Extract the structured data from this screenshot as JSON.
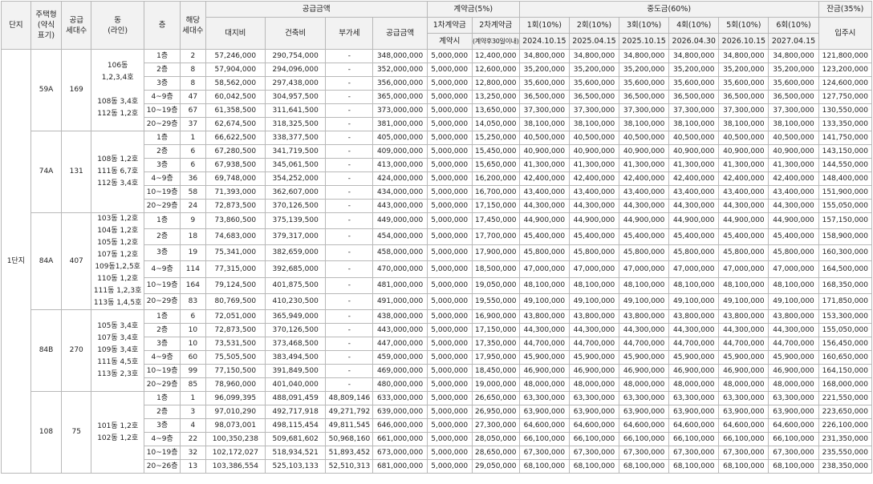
{
  "headers": {
    "danji": "단지",
    "type": "주택형\n(약식\n표기)",
    "supply_units": "공급\n세대수",
    "dong": "동\n(라인)",
    "floor": "층",
    "units": "해당\n세대수",
    "supply_price": "공급금액",
    "land": "대지비",
    "building": "건축비",
    "vat": "부가세",
    "total": "공급금액",
    "contract": "계약금(5%)",
    "c1": "1차계약금",
    "c2": "2차계약금",
    "c1_when": "계약시",
    "c2_when": "(계약후30일이내)",
    "middle": "중도금(60%)",
    "m1": "1회(10%)",
    "m2": "2회(10%)",
    "m3": "3회(10%)",
    "m4": "4회(10%)",
    "m5": "5회(10%)",
    "m6": "6회(10%)",
    "m1_date": "2024.10.15",
    "m2_date": "2025.04.15",
    "m3_date": "2025.10.15",
    "m4_date": "2026.04.30",
    "m5_date": "2026.10.15",
    "m6_date": "2027.04.15",
    "balance": "잔금(35%)",
    "balance_when": "입주시"
  },
  "danji_name": "1단지",
  "groups": [
    {
      "type": "59A",
      "supply": "169",
      "dong": "106동\n1,2,3,4호\n\n108동 3,4호\n112동 1,2호",
      "rows": [
        [
          "1층",
          "2",
          "57,246,000",
          "290,754,000",
          "-",
          "348,000,000",
          "5,000,000",
          "12,400,000",
          "34,800,000",
          "34,800,000",
          "34,800,000",
          "34,800,000",
          "34,800,000",
          "34,800,000",
          "121,800,000"
        ],
        [
          "2층",
          "8",
          "57,904,000",
          "294,096,000",
          "-",
          "352,000,000",
          "5,000,000",
          "12,600,000",
          "35,200,000",
          "35,200,000",
          "35,200,000",
          "35,200,000",
          "35,200,000",
          "35,200,000",
          "123,200,000"
        ],
        [
          "3층",
          "8",
          "58,562,000",
          "297,438,000",
          "-",
          "356,000,000",
          "5,000,000",
          "12,800,000",
          "35,600,000",
          "35,600,000",
          "35,600,000",
          "35,600,000",
          "35,600,000",
          "35,600,000",
          "124,600,000"
        ],
        [
          "4~9층",
          "47",
          "60,042,500",
          "304,957,500",
          "-",
          "365,000,000",
          "5,000,000",
          "13,250,000",
          "36,500,000",
          "36,500,000",
          "36,500,000",
          "36,500,000",
          "36,500,000",
          "36,500,000",
          "127,750,000"
        ],
        [
          "10~19층",
          "67",
          "61,358,500",
          "311,641,500",
          "-",
          "373,000,000",
          "5,000,000",
          "13,650,000",
          "37,300,000",
          "37,300,000",
          "37,300,000",
          "37,300,000",
          "37,300,000",
          "37,300,000",
          "130,550,000"
        ],
        [
          "20~29층",
          "37",
          "62,674,500",
          "318,325,500",
          "-",
          "381,000,000",
          "5,000,000",
          "14,050,000",
          "38,100,000",
          "38,100,000",
          "38,100,000",
          "38,100,000",
          "38,100,000",
          "38,100,000",
          "133,350,000"
        ]
      ]
    },
    {
      "type": "74A",
      "supply": "131",
      "dong": "108동 1,2호\n111동 6,7호\n112동 3,4호",
      "rows": [
        [
          "1층",
          "1",
          "66,622,500",
          "338,377,500",
          "-",
          "405,000,000",
          "5,000,000",
          "15,250,000",
          "40,500,000",
          "40,500,000",
          "40,500,000",
          "40,500,000",
          "40,500,000",
          "40,500,000",
          "141,750,000"
        ],
        [
          "2층",
          "6",
          "67,280,500",
          "341,719,500",
          "-",
          "409,000,000",
          "5,000,000",
          "15,450,000",
          "40,900,000",
          "40,900,000",
          "40,900,000",
          "40,900,000",
          "40,900,000",
          "40,900,000",
          "143,150,000"
        ],
        [
          "3층",
          "6",
          "67,938,500",
          "345,061,500",
          "-",
          "413,000,000",
          "5,000,000",
          "15,650,000",
          "41,300,000",
          "41,300,000",
          "41,300,000",
          "41,300,000",
          "41,300,000",
          "41,300,000",
          "144,550,000"
        ],
        [
          "4~9층",
          "36",
          "69,748,000",
          "354,252,000",
          "-",
          "424,000,000",
          "5,000,000",
          "16,200,000",
          "42,400,000",
          "42,400,000",
          "42,400,000",
          "42,400,000",
          "42,400,000",
          "42,400,000",
          "148,400,000"
        ],
        [
          "10~19층",
          "58",
          "71,393,000",
          "362,607,000",
          "-",
          "434,000,000",
          "5,000,000",
          "16,700,000",
          "43,400,000",
          "43,400,000",
          "43,400,000",
          "43,400,000",
          "43,400,000",
          "43,400,000",
          "151,900,000"
        ],
        [
          "20~29층",
          "24",
          "72,873,500",
          "370,126,500",
          "-",
          "443,000,000",
          "5,000,000",
          "17,150,000",
          "44,300,000",
          "44,300,000",
          "44,300,000",
          "44,300,000",
          "44,300,000",
          "44,300,000",
          "155,050,000"
        ]
      ]
    },
    {
      "type": "84A",
      "supply": "407",
      "dong": "103동 1,2호\n104동 1,2호\n105동 1,2호\n107동 1,2호\n109동1,2,5호\n110동 1,2호\n111동 1,2,3호\n113동 1,4,5호",
      "rows": [
        [
          "1층",
          "9",
          "73,860,500",
          "375,139,500",
          "-",
          "449,000,000",
          "5,000,000",
          "17,450,000",
          "44,900,000",
          "44,900,000",
          "44,900,000",
          "44,900,000",
          "44,900,000",
          "44,900,000",
          "157,150,000"
        ],
        [
          "2층",
          "18",
          "74,683,000",
          "379,317,000",
          "-",
          "454,000,000",
          "5,000,000",
          "17,700,000",
          "45,400,000",
          "45,400,000",
          "45,400,000",
          "45,400,000",
          "45,400,000",
          "45,400,000",
          "158,900,000"
        ],
        [
          "3층",
          "19",
          "75,341,000",
          "382,659,000",
          "-",
          "458,000,000",
          "5,000,000",
          "17,900,000",
          "45,800,000",
          "45,800,000",
          "45,800,000",
          "45,800,000",
          "45,800,000",
          "45,800,000",
          "160,300,000"
        ],
        [
          "4~9층",
          "114",
          "77,315,000",
          "392,685,000",
          "-",
          "470,000,000",
          "5,000,000",
          "18,500,000",
          "47,000,000",
          "47,000,000",
          "47,000,000",
          "47,000,000",
          "47,000,000",
          "47,000,000",
          "164,500,000"
        ],
        [
          "10~19층",
          "164",
          "79,124,500",
          "401,875,500",
          "-",
          "481,000,000",
          "5,000,000",
          "19,050,000",
          "48,100,000",
          "48,100,000",
          "48,100,000",
          "48,100,000",
          "48,100,000",
          "48,100,000",
          "168,350,000"
        ],
        [
          "20~29층",
          "83",
          "80,769,500",
          "410,230,500",
          "-",
          "491,000,000",
          "5,000,000",
          "19,550,000",
          "49,100,000",
          "49,100,000",
          "49,100,000",
          "49,100,000",
          "49,100,000",
          "49,100,000",
          "171,850,000"
        ]
      ]
    },
    {
      "type": "84B",
      "supply": "270",
      "dong": "105동 3,4호\n107동 3,4호\n109동 3,4호\n111동 4,5호\n113동 2,3호",
      "rows": [
        [
          "1층",
          "6",
          "72,051,000",
          "365,949,000",
          "-",
          "438,000,000",
          "5,000,000",
          "16,900,000",
          "43,800,000",
          "43,800,000",
          "43,800,000",
          "43,800,000",
          "43,800,000",
          "43,800,000",
          "153,300,000"
        ],
        [
          "2층",
          "10",
          "72,873,500",
          "370,126,500",
          "-",
          "443,000,000",
          "5,000,000",
          "17,150,000",
          "44,300,000",
          "44,300,000",
          "44,300,000",
          "44,300,000",
          "44,300,000",
          "44,300,000",
          "155,050,000"
        ],
        [
          "3층",
          "10",
          "73,531,500",
          "373,468,500",
          "-",
          "447,000,000",
          "5,000,000",
          "17,350,000",
          "44,700,000",
          "44,700,000",
          "44,700,000",
          "44,700,000",
          "44,700,000",
          "44,700,000",
          "156,450,000"
        ],
        [
          "4~9층",
          "60",
          "75,505,500",
          "383,494,500",
          "-",
          "459,000,000",
          "5,000,000",
          "17,950,000",
          "45,900,000",
          "45,900,000",
          "45,900,000",
          "45,900,000",
          "45,900,000",
          "45,900,000",
          "160,650,000"
        ],
        [
          "10~19층",
          "99",
          "77,150,500",
          "391,849,500",
          "-",
          "469,000,000",
          "5,000,000",
          "18,450,000",
          "46,900,000",
          "46,900,000",
          "46,900,000",
          "46,900,000",
          "46,900,000",
          "46,900,000",
          "164,150,000"
        ],
        [
          "20~29층",
          "85",
          "78,960,000",
          "401,040,000",
          "-",
          "480,000,000",
          "5,000,000",
          "19,000,000",
          "48,000,000",
          "48,000,000",
          "48,000,000",
          "48,000,000",
          "48,000,000",
          "48,000,000",
          "168,000,000"
        ]
      ]
    },
    {
      "type": "108",
      "supply": "75",
      "dong": "101동 1,2호\n102동 1,2호",
      "rows": [
        [
          "1층",
          "1",
          "96,099,395",
          "488,091,459",
          "48,809,146",
          "633,000,000",
          "5,000,000",
          "26,650,000",
          "63,300,000",
          "63,300,000",
          "63,300,000",
          "63,300,000",
          "63,300,000",
          "63,300,000",
          "221,550,000"
        ],
        [
          "2층",
          "3",
          "97,010,290",
          "492,717,918",
          "49,271,792",
          "639,000,000",
          "5,000,000",
          "26,950,000",
          "63,900,000",
          "63,900,000",
          "63,900,000",
          "63,900,000",
          "63,900,000",
          "63,900,000",
          "223,650,000"
        ],
        [
          "3층",
          "4",
          "98,073,001",
          "498,115,454",
          "49,811,545",
          "646,000,000",
          "5,000,000",
          "27,300,000",
          "64,600,000",
          "64,600,000",
          "64,600,000",
          "64,600,000",
          "64,600,000",
          "64,600,000",
          "226,100,000"
        ],
        [
          "4~9층",
          "22",
          "100,350,238",
          "509,681,602",
          "50,968,160",
          "661,000,000",
          "5,000,000",
          "28,050,000",
          "66,100,000",
          "66,100,000",
          "66,100,000",
          "66,100,000",
          "66,100,000",
          "66,100,000",
          "231,350,000"
        ],
        [
          "10~19층",
          "32",
          "102,172,027",
          "518,934,521",
          "51,893,452",
          "673,000,000",
          "5,000,000",
          "28,650,000",
          "67,300,000",
          "67,300,000",
          "67,300,000",
          "67,300,000",
          "67,300,000",
          "67,300,000",
          "235,550,000"
        ],
        [
          "20~26층",
          "13",
          "103,386,554",
          "525,103,133",
          "52,510,313",
          "681,000,000",
          "5,000,000",
          "29,050,000",
          "68,100,000",
          "68,100,000",
          "68,100,000",
          "68,100,000",
          "68,100,000",
          "68,100,000",
          "238,350,000"
        ]
      ]
    }
  ]
}
